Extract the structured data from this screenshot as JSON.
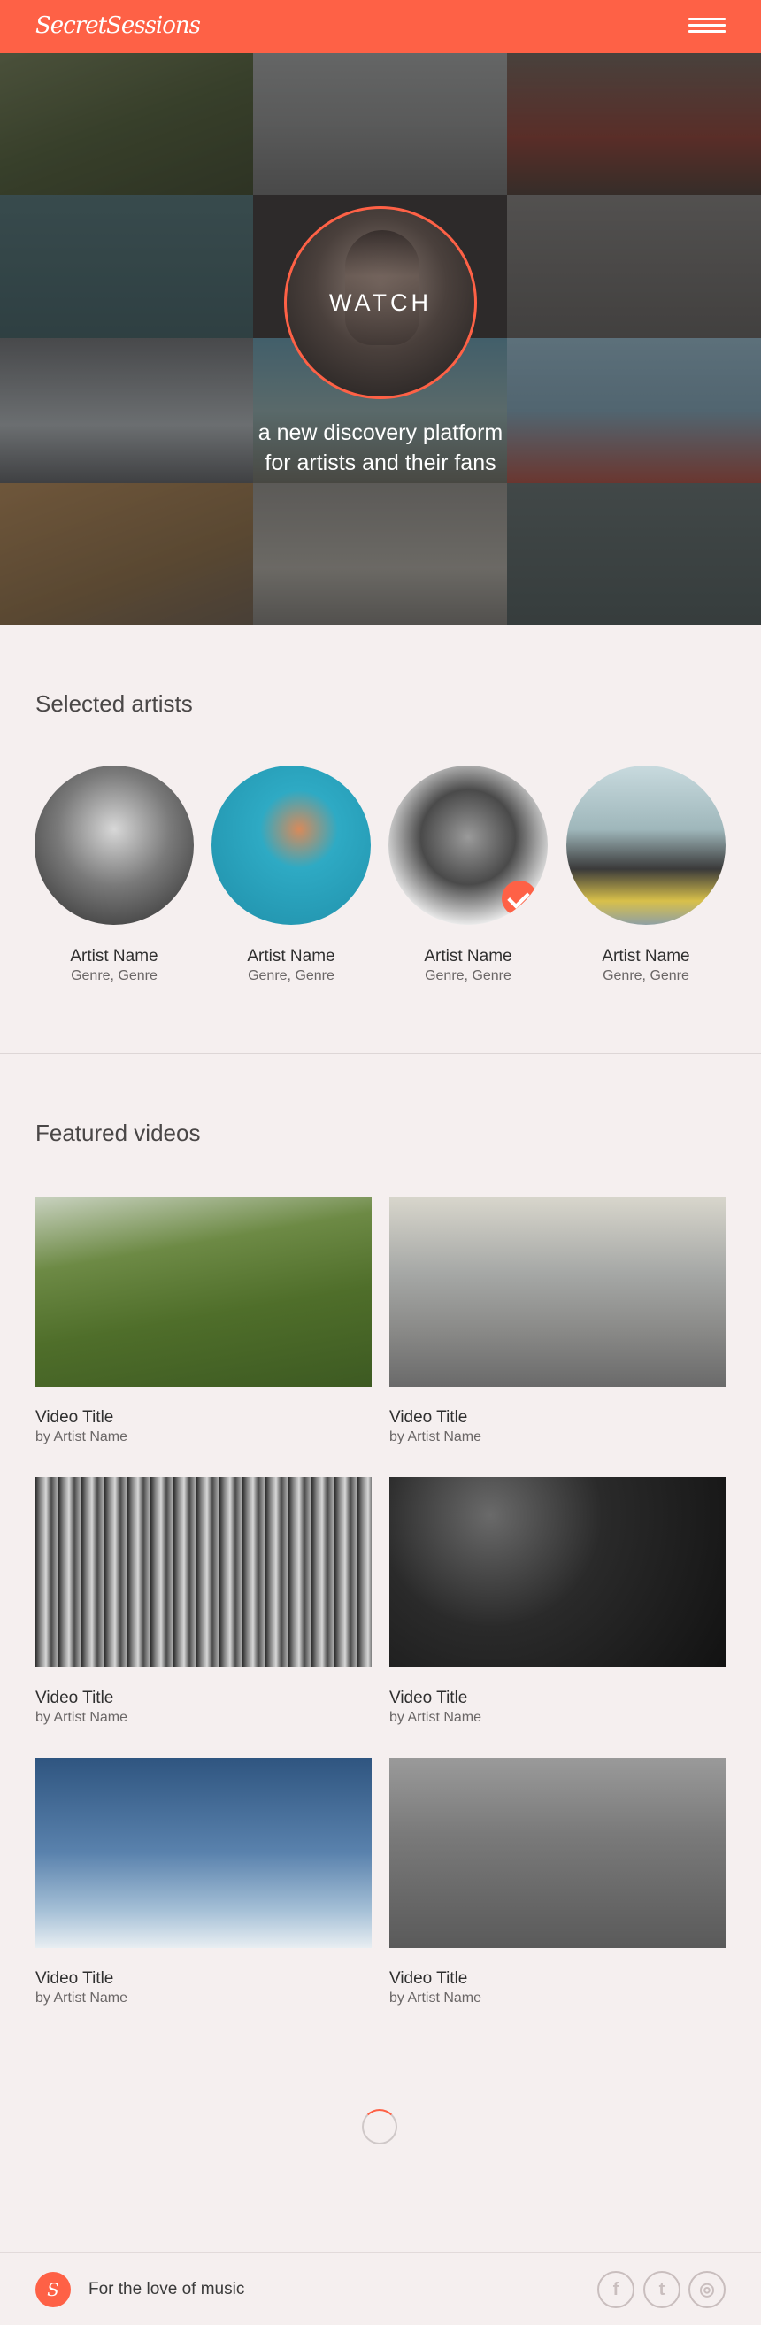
{
  "header": {
    "logo": "SecretSessions",
    "menu_icon": "hamburger-menu-icon"
  },
  "hero": {
    "watch_label": "WATCH",
    "tagline_line1": "a new discovery platform",
    "tagline_line2": "for artists and their fans"
  },
  "artists_section": {
    "title": "Selected artists",
    "items": [
      {
        "name": "Artist Name",
        "genre": "Genre, Genre",
        "selected": false
      },
      {
        "name": "Artist Name",
        "genre": "Genre, Genre",
        "selected": false
      },
      {
        "name": "Artist Name",
        "genre": "Genre, Genre",
        "selected": true
      },
      {
        "name": "Artist Name",
        "genre": "Genre, Genre",
        "selected": false
      }
    ]
  },
  "videos_section": {
    "title": "Featured videos",
    "items": [
      {
        "title": "Video Title",
        "artist": "by Artist Name"
      },
      {
        "title": "Video Title",
        "artist": "by Artist Name"
      },
      {
        "title": "Video Title",
        "artist": "by Artist Name"
      },
      {
        "title": "Video Title",
        "artist": "by Artist Name"
      },
      {
        "title": "Video Title",
        "artist": "by Artist Name"
      },
      {
        "title": "Video Title",
        "artist": "by Artist Name"
      }
    ]
  },
  "footer": {
    "logo": "S",
    "text": "For the love of music",
    "social": [
      {
        "icon": "facebook-icon",
        "glyph": "f"
      },
      {
        "icon": "twitter-icon",
        "glyph": "t"
      },
      {
        "icon": "instagram-icon",
        "glyph": "◎"
      }
    ]
  },
  "colors": {
    "accent": "#fe6146",
    "background": "#f5efef"
  }
}
